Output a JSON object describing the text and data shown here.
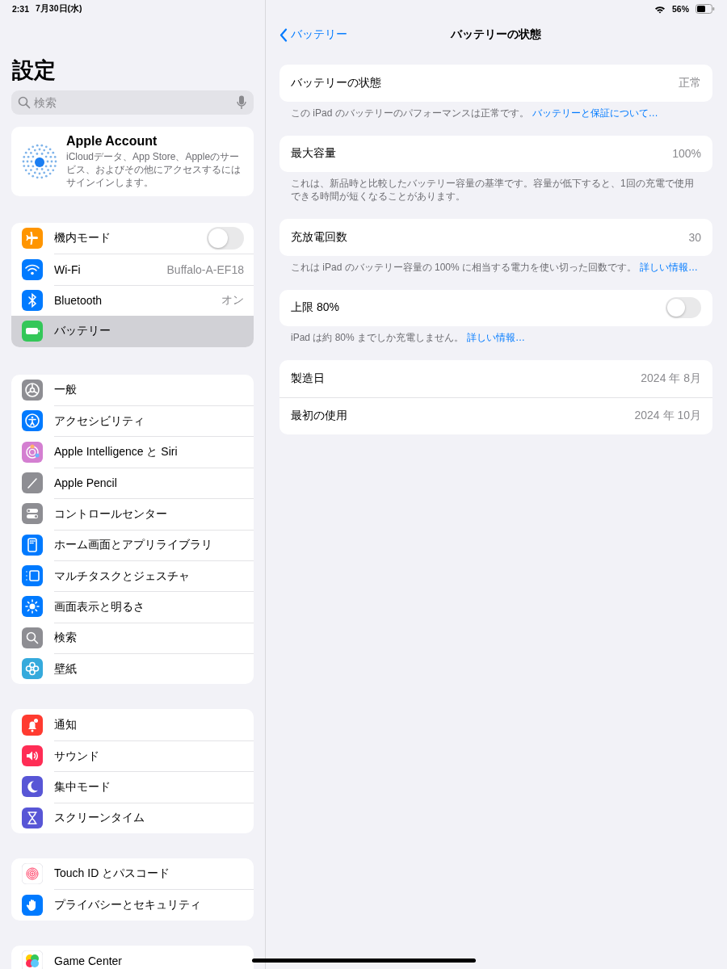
{
  "status_bar": {
    "time": "2:31",
    "date": "7月30日(水)",
    "battery": "56%"
  },
  "sidebar": {
    "title": "設定",
    "search": {
      "placeholder": "検索"
    },
    "account": {
      "name": "Apple Account",
      "description": "iCloudデータ、App Store、Appleのサービス、およびその他にアクセスするにはサインインします。"
    },
    "groups": [
      {
        "items": [
          {
            "kind": "toggle",
            "label": "機内モード",
            "on": false,
            "selected": false
          },
          {
            "kind": "value",
            "label": "Wi-Fi",
            "value": "Buffalo-A-EF18",
            "selected": false
          },
          {
            "kind": "value",
            "label": "Bluetooth",
            "value": "オン",
            "selected": false
          },
          {
            "kind": "link",
            "label": "バッテリー",
            "selected": true
          }
        ]
      },
      {
        "items": [
          {
            "kind": "link",
            "label": "一般",
            "selected": false
          },
          {
            "kind": "link",
            "label": "アクセシビリティ",
            "selected": false
          },
          {
            "kind": "link",
            "label": "Apple Intelligence と Siri",
            "selected": false
          },
          {
            "kind": "link",
            "label": "Apple Pencil",
            "selected": false
          },
          {
            "kind": "link",
            "label": "コントロールセンター",
            "selected": false
          },
          {
            "kind": "link",
            "label": "ホーム画面とアプリライブラリ",
            "selected": false
          },
          {
            "kind": "link",
            "label": "マルチタスクとジェスチャ",
            "selected": false
          },
          {
            "kind": "link",
            "label": "画面表示と明るさ",
            "selected": false
          },
          {
            "kind": "link",
            "label": "検索",
            "selected": false
          },
          {
            "kind": "link",
            "label": "壁紙",
            "selected": false
          }
        ]
      },
      {
        "items": [
          {
            "kind": "link",
            "label": "通知",
            "selected": false
          },
          {
            "kind": "link",
            "label": "サウンド",
            "selected": false
          },
          {
            "kind": "link",
            "label": "集中モード",
            "selected": false
          },
          {
            "kind": "link",
            "label": "スクリーンタイム",
            "selected": false
          }
        ]
      },
      {
        "items": [
          {
            "kind": "link",
            "label": "Touch ID とパスコード",
            "selected": false
          },
          {
            "kind": "link",
            "label": "プライバシーとセキュリティ",
            "selected": false
          }
        ]
      },
      {
        "items": [
          {
            "kind": "link",
            "label": "Game Center",
            "selected": false
          }
        ]
      }
    ]
  },
  "detail": {
    "back": "バッテリー",
    "title": "バッテリーの状態",
    "sections": [
      {
        "rows": [
          {
            "kind": "value",
            "label": "バッテリーの状態",
            "value": "正常"
          }
        ],
        "footer": {
          "text": "この iPad のバッテリーのパフォーマンスは正常です。",
          "link": "バッテリーと保証について…"
        }
      },
      {
        "rows": [
          {
            "kind": "value",
            "label": "最大容量",
            "value": "100%"
          }
        ],
        "footer": {
          "text": "これは、新品時と比較したバッテリー容量の基準です。容量が低下すると、1回の充電で使用できる時間が短くなることがあります。"
        }
      },
      {
        "rows": [
          {
            "kind": "value",
            "label": "充放電回数",
            "value": "30"
          }
        ],
        "footer": {
          "text": "これは iPad のバッテリー容量の 100% に相当する電力を使い切った回数です。",
          "link": "詳しい情報…"
        }
      },
      {
        "rows": [
          {
            "kind": "toggle",
            "label": "上限 80%",
            "on": false
          }
        ],
        "footer": {
          "text": "iPad は約 80% までしか充電しません。",
          "link": "詳しい情報…"
        }
      },
      {
        "rows": [
          {
            "kind": "value",
            "label": "製造日",
            "value": "2024 年 8月"
          },
          {
            "kind": "value",
            "label": "最初の使用",
            "value": "2024 年 10月"
          }
        ]
      }
    ]
  }
}
